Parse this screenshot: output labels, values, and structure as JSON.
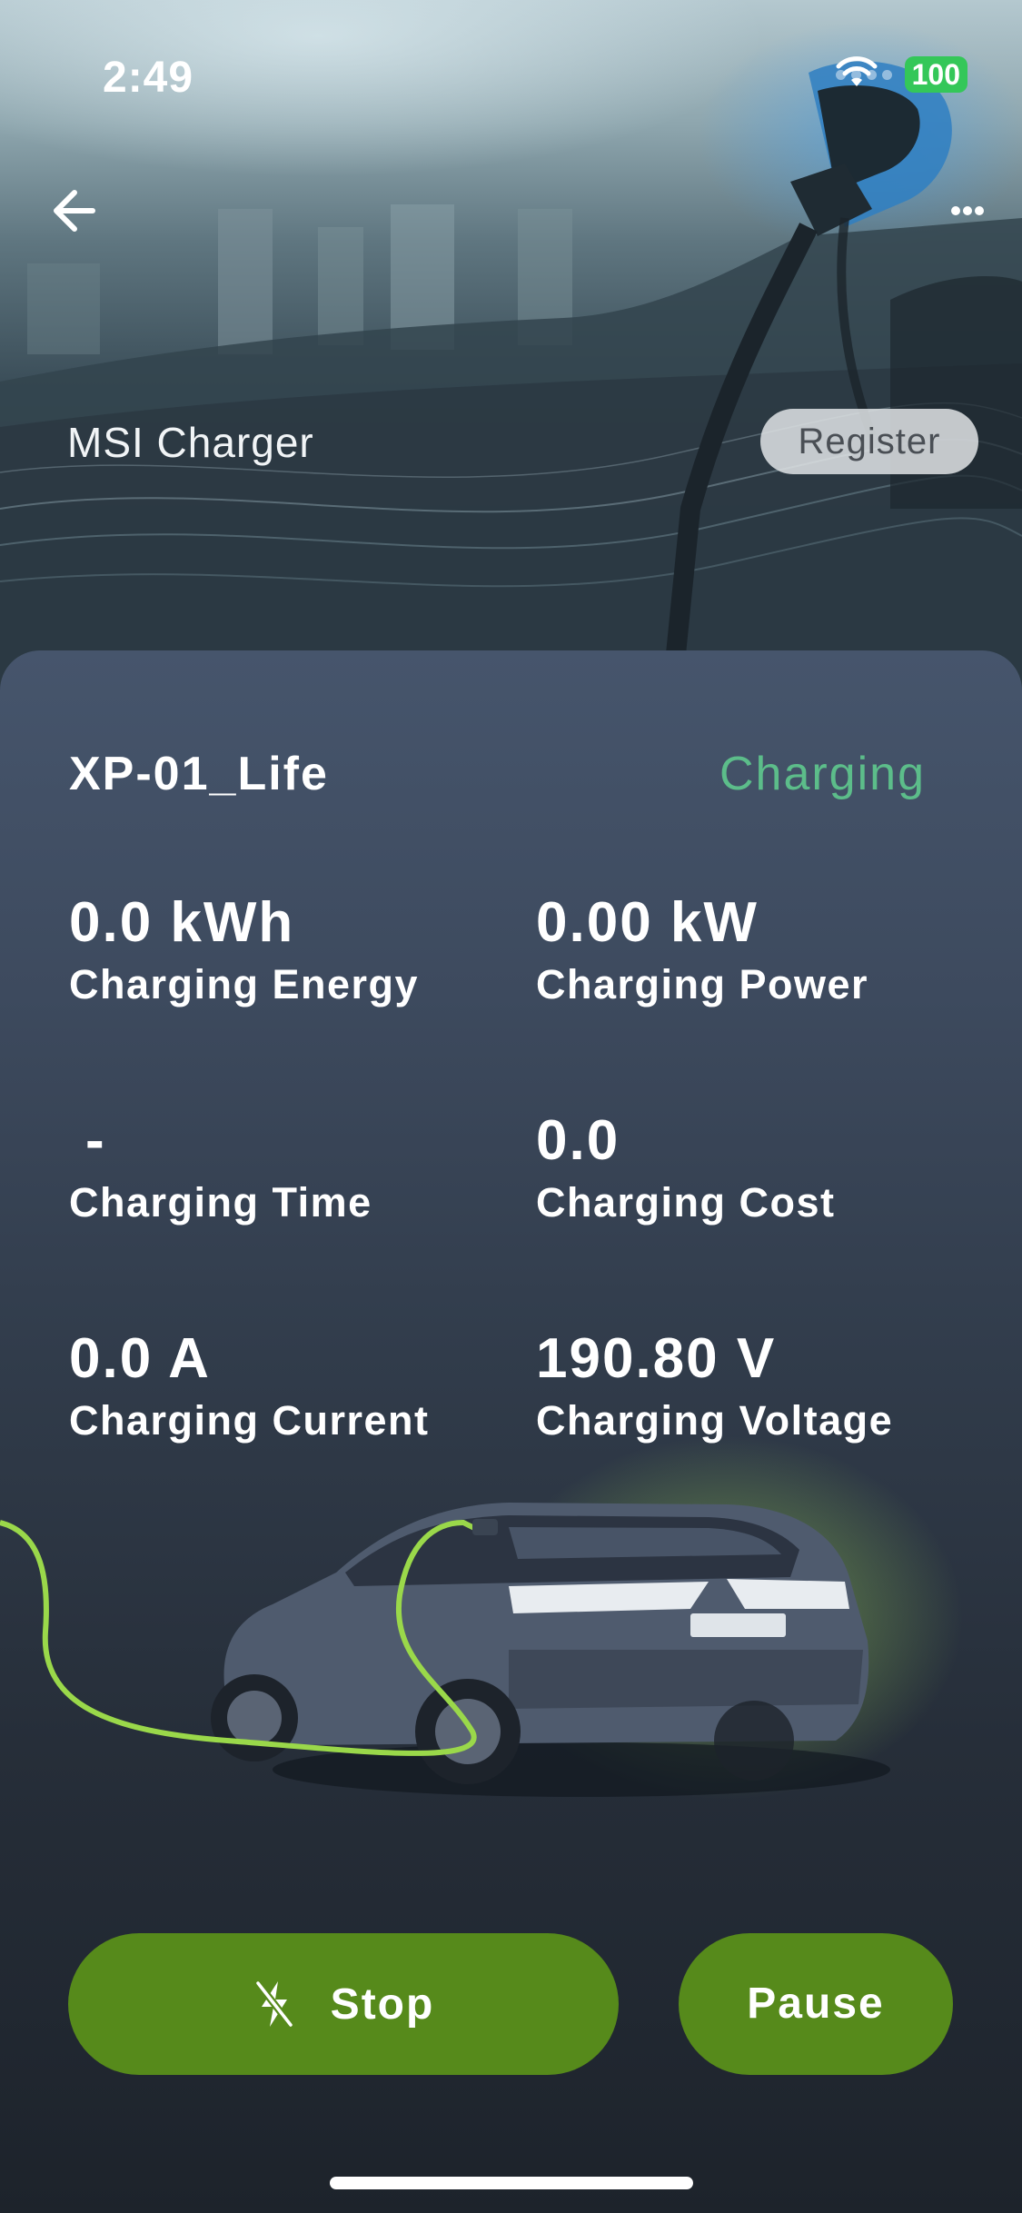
{
  "status_bar": {
    "time": "2:49",
    "battery": "100"
  },
  "header": {
    "charger_name": "MSI Charger",
    "register_label": "Register"
  },
  "device": {
    "name": "XP-01_Life",
    "status": "Charging",
    "status_color": "#5cbd8a"
  },
  "stats": {
    "energy": {
      "value": "0.0 kWh",
      "label": "Charging Energy"
    },
    "power": {
      "value": "0.00 kW",
      "label": "Charging Power"
    },
    "time": {
      "value": "-",
      "label": "Charging Time"
    },
    "cost": {
      "value": "0.0",
      "label": "Charging Cost"
    },
    "current": {
      "value": "0.0 A",
      "label": "Charging Current"
    },
    "voltage": {
      "value": "190.80 V",
      "label": "Charging Voltage"
    }
  },
  "actions": {
    "stop_label": "Stop",
    "pause_label": "Pause",
    "button_color": "#568a1b"
  },
  "icons": {
    "back": "arrow-left-icon",
    "more": "more-horizontal-icon",
    "stop": "bolt-off-icon",
    "wifi": "wifi-icon"
  }
}
